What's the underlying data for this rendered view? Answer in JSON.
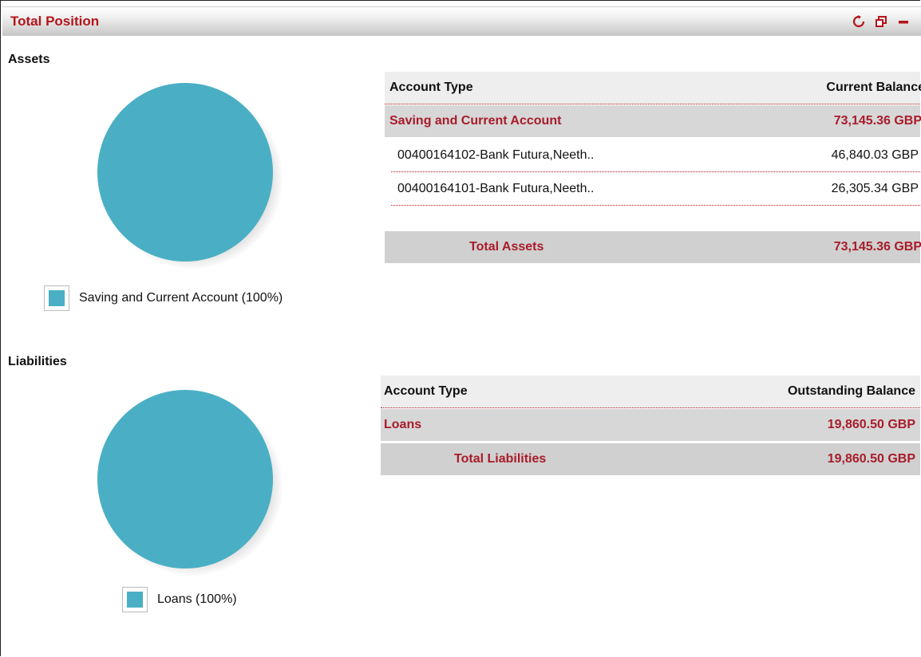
{
  "panel": {
    "title": "Total Position"
  },
  "controls": {
    "refresh_icon": "refresh-icon",
    "restore_icon": "restore-window-icon",
    "minimize_icon": "minimize-icon"
  },
  "colors": {
    "accent": "#b3141b",
    "pie": "#4aafc4"
  },
  "assets": {
    "label": "Assets",
    "legend": "Saving and Current Account (100%)",
    "table": {
      "col_type": "Account Type",
      "col_balance": "Current Balance",
      "category": {
        "name": "Saving and Current Account",
        "amount": "73,145.36 GBP"
      },
      "accounts": [
        {
          "name": "00400164102-Bank Futura,Neeth..",
          "amount": "46,840.03 GBP"
        },
        {
          "name": "00400164101-Bank Futura,Neeth..",
          "amount": "26,305.34 GBP"
        }
      ],
      "total": {
        "label": "Total Assets",
        "amount": "73,145.36 GBP"
      }
    }
  },
  "liabilities": {
    "label": "Liabilities",
    "legend": "Loans (100%)",
    "table": {
      "col_type": "Account Type",
      "col_balance": "Outstanding Balance",
      "category": {
        "name": "Loans",
        "amount": "19,860.50 GBP"
      },
      "total": {
        "label": "Total Liabilities",
        "amount": "19,860.50 GBP"
      }
    }
  }
}
